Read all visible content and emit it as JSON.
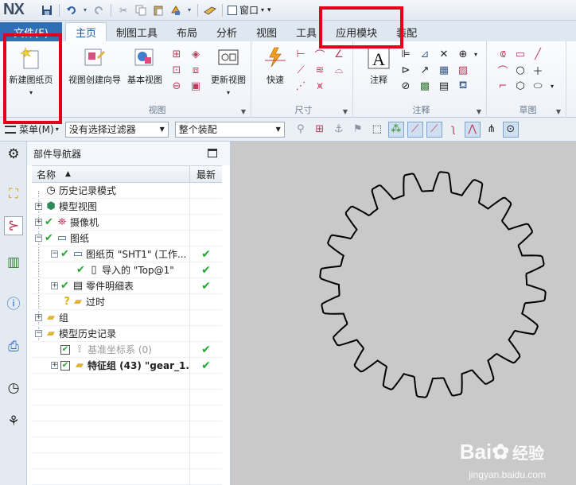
{
  "app": {
    "logo": "NX",
    "window_menu": "窗口"
  },
  "tabs": [
    {
      "label": "文件(F)"
    },
    {
      "label": "主页"
    },
    {
      "label": "制图工具"
    },
    {
      "label": "布局"
    },
    {
      "label": "分析"
    },
    {
      "label": "视图"
    },
    {
      "label": "工具"
    },
    {
      "label": "应用模块"
    },
    {
      "label": "装配"
    }
  ],
  "ribbon": {
    "new_sheet": "新建图纸页",
    "view_wizard": "视图创建向导",
    "base_view": "基本视图",
    "update_view": "更新视图",
    "quick": "快速",
    "note": "注释",
    "group_view": "视图",
    "group_dimension": "尺寸",
    "group_annotation": "注释",
    "group_sketch": "草图"
  },
  "selection_bar": {
    "menu": "菜单(M)",
    "filter": "没有选择过滤器",
    "scope": "整个装配"
  },
  "navigator": {
    "title": "部件导航器",
    "col_name": "名称",
    "col_new": "最新",
    "rows": [
      {
        "label": "历史记录模式"
      },
      {
        "label": "模型视图"
      },
      {
        "label": "摄像机"
      },
      {
        "label": "图纸"
      },
      {
        "label": "图纸页 \"SHT1\" (工作..."
      },
      {
        "label": "导入的 \"Top@1\""
      },
      {
        "label": "零件明细表"
      },
      {
        "label": "过时"
      },
      {
        "label": "组"
      },
      {
        "label": "模型历史记录"
      },
      {
        "label": "基准坐标系 (0)"
      },
      {
        "label": "特征组 (43) \"gear_1..."
      }
    ]
  },
  "watermark": {
    "brand": "Bai",
    "brand2": "经验",
    "url": "jingyan.baidu.com"
  }
}
